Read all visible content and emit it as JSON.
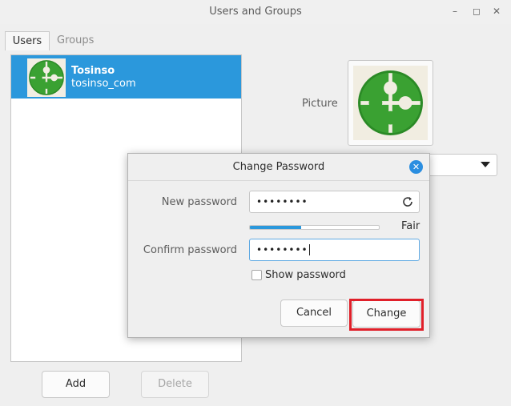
{
  "window": {
    "title": "Users and Groups",
    "minimize_icon": "minimize-icon",
    "maximize_icon": "maximize-icon",
    "close_icon": "close-icon"
  },
  "tabs": [
    {
      "label": "Users",
      "active": true
    },
    {
      "label": "Groups",
      "active": false
    }
  ],
  "users": [
    {
      "name": "Tosinso",
      "login": "tosinso_com",
      "selected": true
    }
  ],
  "list_buttons": {
    "add": "Add",
    "delete": "Delete"
  },
  "details": {
    "picture_label": "Picture"
  },
  "dialog": {
    "title": "Change Password",
    "new_password_label": "New password",
    "new_password_value": "••••••••",
    "confirm_password_label": "Confirm password",
    "confirm_password_value": "••••••••",
    "strength_text": "Fair",
    "strength_level": 0.4,
    "show_password_label": "Show password",
    "show_password_checked": false,
    "cancel_label": "Cancel",
    "change_label": "Change"
  },
  "colors": {
    "selection": "#2b98dc",
    "highlight": "#e0202a",
    "avatar_green": "#3aa132"
  }
}
